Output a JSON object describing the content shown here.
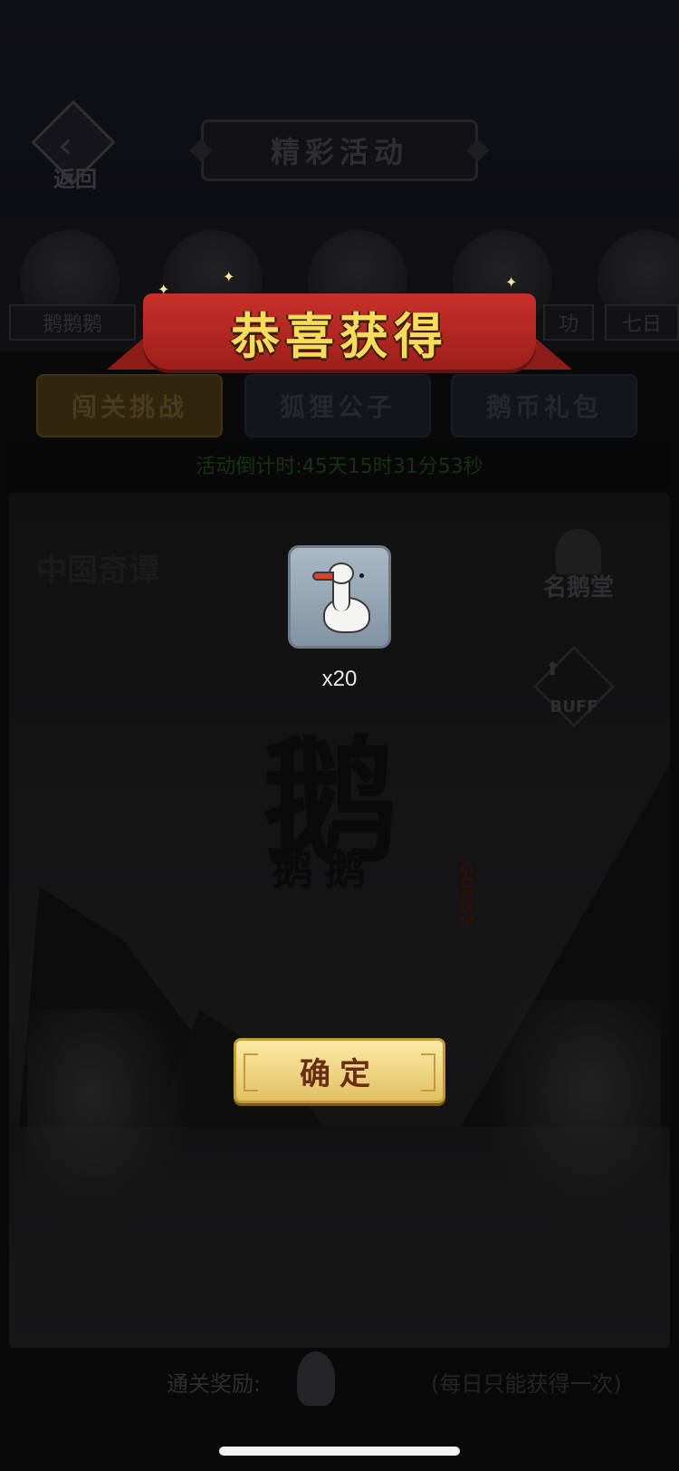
{
  "header": {
    "back_label": "返回",
    "title": "精彩活动"
  },
  "hero_row": {
    "tags": [
      "鹅鹅鹅",
      "功",
      "七日"
    ]
  },
  "tabs": [
    {
      "label": "闯关挑战",
      "active": true
    },
    {
      "label": "狐狸公子",
      "active": false
    },
    {
      "label": "鹅币礼包",
      "active": false
    }
  ],
  "countdown": {
    "text": "活动倒计时:45天15时31分53秒"
  },
  "scene": {
    "logo_text": "中国奇谭",
    "big_char": "鹅",
    "small_chars": "鹅鹅",
    "seal_text": "GOOSE",
    "hall_button_label": "名鹅堂",
    "buff_label": "BUFF"
  },
  "reward_bar": {
    "label": "通关奖励:",
    "note": "(每日只能获得一次)"
  },
  "popup": {
    "banner_title": "恭喜获得",
    "item_icon": "goose-icon",
    "item_count": "x20",
    "confirm_label": "确定"
  },
  "colors": {
    "banner_red": "#c8312a",
    "banner_text_gold": "#f6dc5a",
    "confirm_gold": "#e2c064",
    "countdown_green": "#1f3d18"
  }
}
